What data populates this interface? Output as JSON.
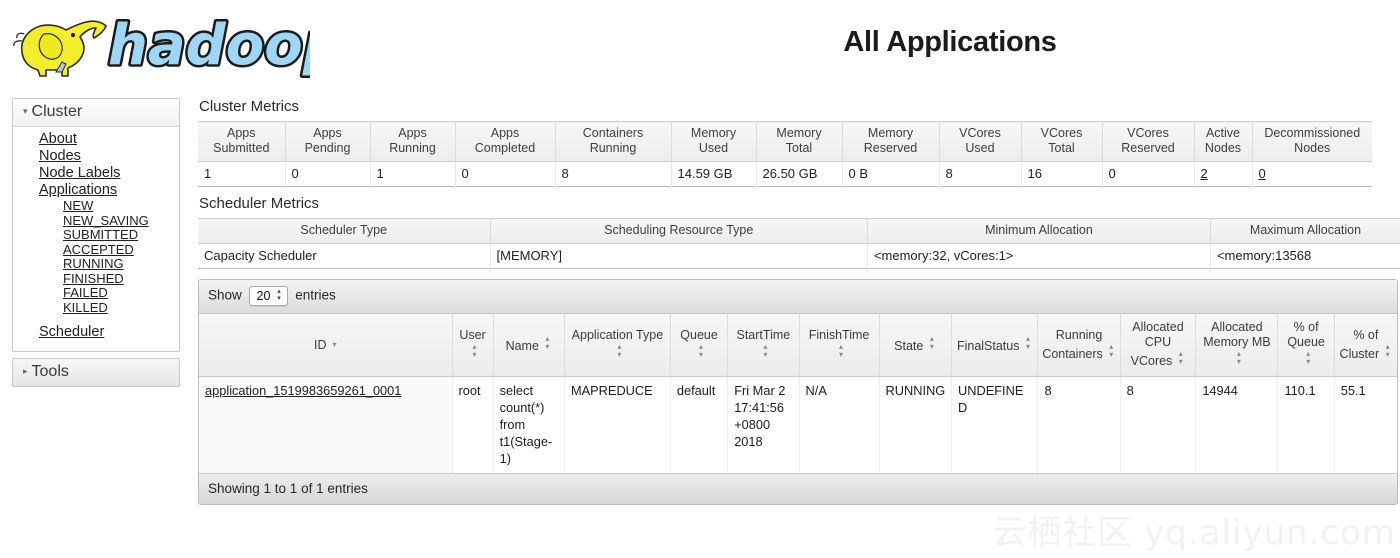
{
  "header": {
    "title": "All Applications",
    "logo_alt": "hadoop-logo"
  },
  "sidebar": {
    "cluster": {
      "label": "Cluster",
      "expanded_marker": "▾",
      "items": [
        {
          "label": "About"
        },
        {
          "label": "Nodes"
        },
        {
          "label": "Node Labels"
        },
        {
          "label": "Applications"
        }
      ],
      "application_states": [
        {
          "label": "NEW"
        },
        {
          "label": "NEW_SAVING"
        },
        {
          "label": "SUBMITTED"
        },
        {
          "label": "ACCEPTED"
        },
        {
          "label": "RUNNING"
        },
        {
          "label": "FINISHED"
        },
        {
          "label": "FAILED"
        },
        {
          "label": "KILLED"
        }
      ],
      "scheduler": {
        "label": "Scheduler"
      }
    },
    "tools": {
      "label": "Tools",
      "collapsed_marker": "▸"
    }
  },
  "cluster_metrics": {
    "title": "Cluster Metrics",
    "columns": [
      "Apps Submitted",
      "Apps Pending",
      "Apps Running",
      "Apps Completed",
      "Containers Running",
      "Memory Used",
      "Memory Total",
      "Memory Reserved",
      "VCores Used",
      "VCores Total",
      "VCores Reserved",
      "Active Nodes",
      "Decommissioned Nodes"
    ],
    "values": [
      "1",
      "0",
      "1",
      "0",
      "8",
      "14.59 GB",
      "26.50 GB",
      "0 B",
      "8",
      "16",
      "0",
      "2",
      "0"
    ],
    "link_columns": [
      11,
      12
    ]
  },
  "scheduler_metrics": {
    "title": "Scheduler Metrics",
    "columns": [
      "Scheduler Type",
      "Scheduling Resource Type",
      "Minimum Allocation",
      "Maximum Allocation"
    ],
    "values": [
      "Capacity Scheduler",
      "[MEMORY]",
      "<memory:32, vCores:1>",
      "<memory:13568"
    ]
  },
  "apps_table": {
    "show_label": "Show",
    "entries_label": "entries",
    "page_length": "20",
    "stepper_up": "▴",
    "stepper_down": "▾",
    "sort_neutral_up": "▴",
    "sort_neutral_down": "▾",
    "sort_desc": "▾",
    "columns": [
      {
        "label": "ID",
        "sort": "desc"
      },
      {
        "label": "User",
        "sort": "none"
      },
      {
        "label": "Name",
        "sort": "none"
      },
      {
        "label": "Application Type",
        "sort": "none"
      },
      {
        "label": "Queue",
        "sort": "none"
      },
      {
        "label": "StartTime",
        "sort": "none"
      },
      {
        "label": "FinishTime",
        "sort": "none"
      },
      {
        "label": "State",
        "sort": "none"
      },
      {
        "label": "FinalStatus",
        "sort": "none"
      },
      {
        "label": "Running Containers",
        "sort": "none"
      },
      {
        "label": "Allocated CPU VCores",
        "sort": "none"
      },
      {
        "label": "Allocated Memory MB",
        "sort": "none"
      },
      {
        "label": "% of Queue",
        "sort": "none"
      },
      {
        "label": "% of Cluster",
        "sort": "none"
      }
    ],
    "rows": [
      {
        "id": "application_1519983659261_0001",
        "user": "root",
        "name": "select count(*) from t1(Stage-1)",
        "application_type": "MAPREDUCE",
        "queue": "default",
        "start_time": "Fri Mar 2 17:41:56 +0800 2018",
        "finish_time": "N/A",
        "state": "RUNNING",
        "final_status": "UNDEFINED",
        "running_containers": "8",
        "allocated_cpu_vcores": "8",
        "allocated_memory_mb": "14944",
        "pct_of_queue": "110.1",
        "pct_of_cluster": "55.1"
      }
    ],
    "info": "Showing 1 to 1 of 1 entries"
  },
  "watermark": {
    "text": "云栖社区 yq.aliyun.com"
  }
}
